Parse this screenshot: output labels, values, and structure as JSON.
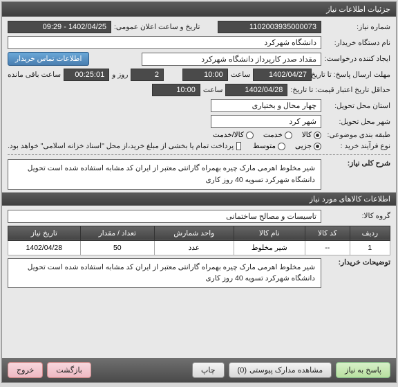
{
  "titlebar": "جزئیات اطلاعات نیاز",
  "fields": {
    "need_no_label": "شماره نیاز:",
    "need_no": "1102003935000073",
    "pub_datetime_label": "تاریخ و ساعت اعلان عمومی:",
    "pub_datetime": "1402/04/25 - 09:29",
    "buyer_label": "نام دستگاه خریدار:",
    "buyer": "دانشگاه شهرکرد",
    "requester_label": "ایجاد کننده درخواست:",
    "requester": "مقداد صدر کارپرداز دانشگاه شهرکرد",
    "contact_btn": "اطلاعات تماس خریدار",
    "deadline_label": "مهلت ارسال پاسخ: تا تاریخ:",
    "deadline_date": "1402/04/27",
    "time_lbl": "ساعت",
    "deadline_time": "10:00",
    "days_remain": "2",
    "days_lbl": "روز و",
    "countdown": "00:25:01",
    "remain_lbl": "ساعت باقی مانده",
    "validity_label": "حداقل تاریخ اعتبار قیمت: تا تاریخ:",
    "validity_date": "1402/04/28",
    "validity_time": "10:00",
    "deliver_prov_label": "استان محل تحویل:",
    "deliver_prov": "چهار محال و بختیاری",
    "deliver_city_label": "شهر محل تحویل:",
    "deliver_city": "شهر کرد",
    "class_label": "طبقه بندی موضوعی:",
    "radios_class": [
      {
        "label": "کالا",
        "selected": true
      },
      {
        "label": "خدمت",
        "selected": false
      },
      {
        "label": "کالا/خدمت",
        "selected": false
      }
    ],
    "process_label": "نوع فرآیند خرید :",
    "radios_proc": [
      {
        "label": "جزیی",
        "selected": true
      },
      {
        "label": "متوسط",
        "selected": false
      }
    ],
    "payment_chk_label": "پرداخت تمام یا بخشی از مبلغ خرید،از محل \"اسناد خزانه اسلامی\" خواهد بود.",
    "desc_title_label": "شرح کلی نیاز:",
    "desc_text": "شیر مخلوط اهرمی مارک چیره بهمراه گارانتی معتبر از ایران کد مشابه استفاده شده است تحویل دانشگاه شهرکرد تسویه 40 روز کاری"
  },
  "items_section": {
    "title": "اطلاعات کالاهای مورد نیاز",
    "group_label": "گروه کالا:",
    "group_value": "تاسیسات و مصالح ساختمانی",
    "columns": [
      "ردیف",
      "کد کالا",
      "نام کالا",
      "واحد شمارش",
      "تعداد / مقدار",
      "تاریخ نیاز"
    ],
    "rows": [
      {
        "idx": "1",
        "code": "--",
        "name": "شیر مخلوط",
        "unit": "عدد",
        "qty": "50",
        "date": "1402/04/28"
      }
    ],
    "buyer_note_label": "توضیحات خریدار:",
    "buyer_note": "شیر مخلوط اهرمی مارک چیره بهمراه گارانتی معتبر از ایران کد مشابه استفاده شده است تحویل دانشگاه شهرکرد تسویه 40 روز کاری"
  },
  "footer": {
    "reply": "پاسخ به نیاز",
    "attachments": "مشاهده مدارک پیوستی",
    "attach_count": "(0)",
    "print": "چاپ",
    "back": "بازگشت",
    "exit": "خروج"
  }
}
